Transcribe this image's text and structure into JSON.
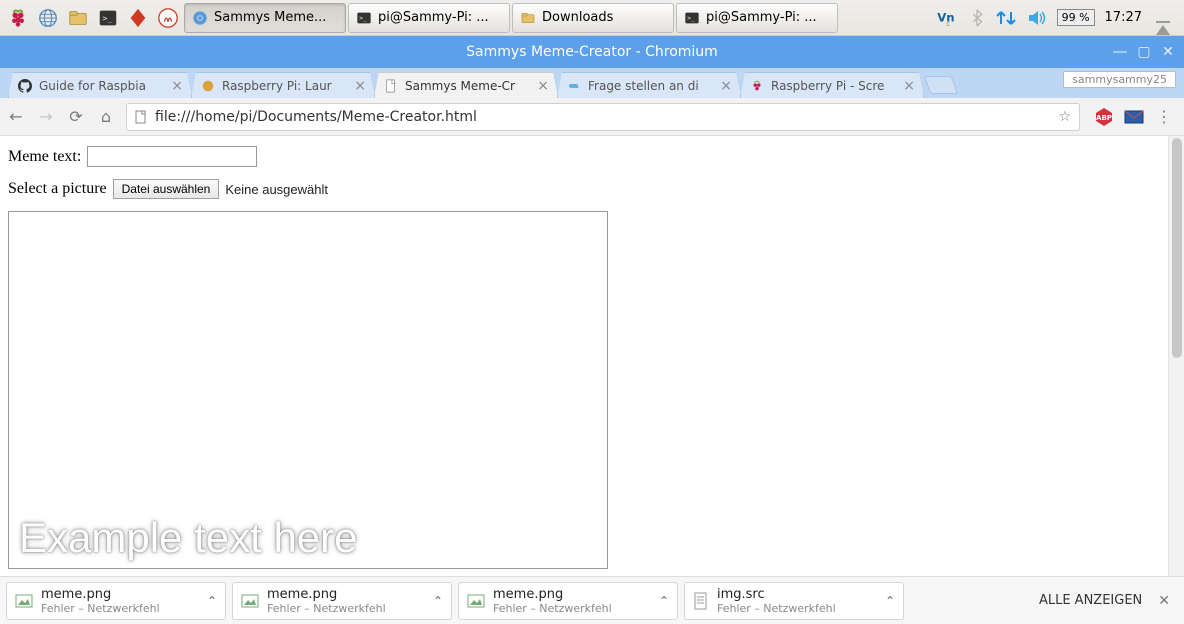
{
  "taskbar": {
    "items": [
      {
        "label": "Sammys Meme..."
      },
      {
        "label": "pi@Sammy-Pi: ..."
      },
      {
        "label": "Downloads"
      },
      {
        "label": "pi@Sammy-Pi: ..."
      }
    ],
    "battery": "99 %",
    "clock": "17:27"
  },
  "chrome": {
    "window_title": "Sammys Meme-Creator - Chromium",
    "user_badge": "sammysammy25",
    "tabs": [
      {
        "label": "Guide for Raspbia"
      },
      {
        "label": "Raspberry Pi: Laur"
      },
      {
        "label": "Sammys Meme-Cr"
      },
      {
        "label": "Frage stellen an di"
      },
      {
        "label": "Raspberry Pi - Scre"
      }
    ],
    "url": "file:///home/pi/Documents/Meme-Creator.html"
  },
  "page": {
    "meme_label": "Meme text:",
    "select_label": "Select a picture",
    "file_button": "Datei auswählen",
    "file_status": "Keine ausgewählt",
    "overlay_text": "Example text here"
  },
  "downloads": {
    "items": [
      {
        "name": "meme.png",
        "status": "Fehler – Netzwerkfehl"
      },
      {
        "name": "meme.png",
        "status": "Fehler – Netzwerkfehl"
      },
      {
        "name": "meme.png",
        "status": "Fehler – Netzwerkfehl"
      },
      {
        "name": "img.src",
        "status": "Fehler – Netzwerkfehl"
      }
    ],
    "show_all": "ALLE ANZEIGEN"
  }
}
